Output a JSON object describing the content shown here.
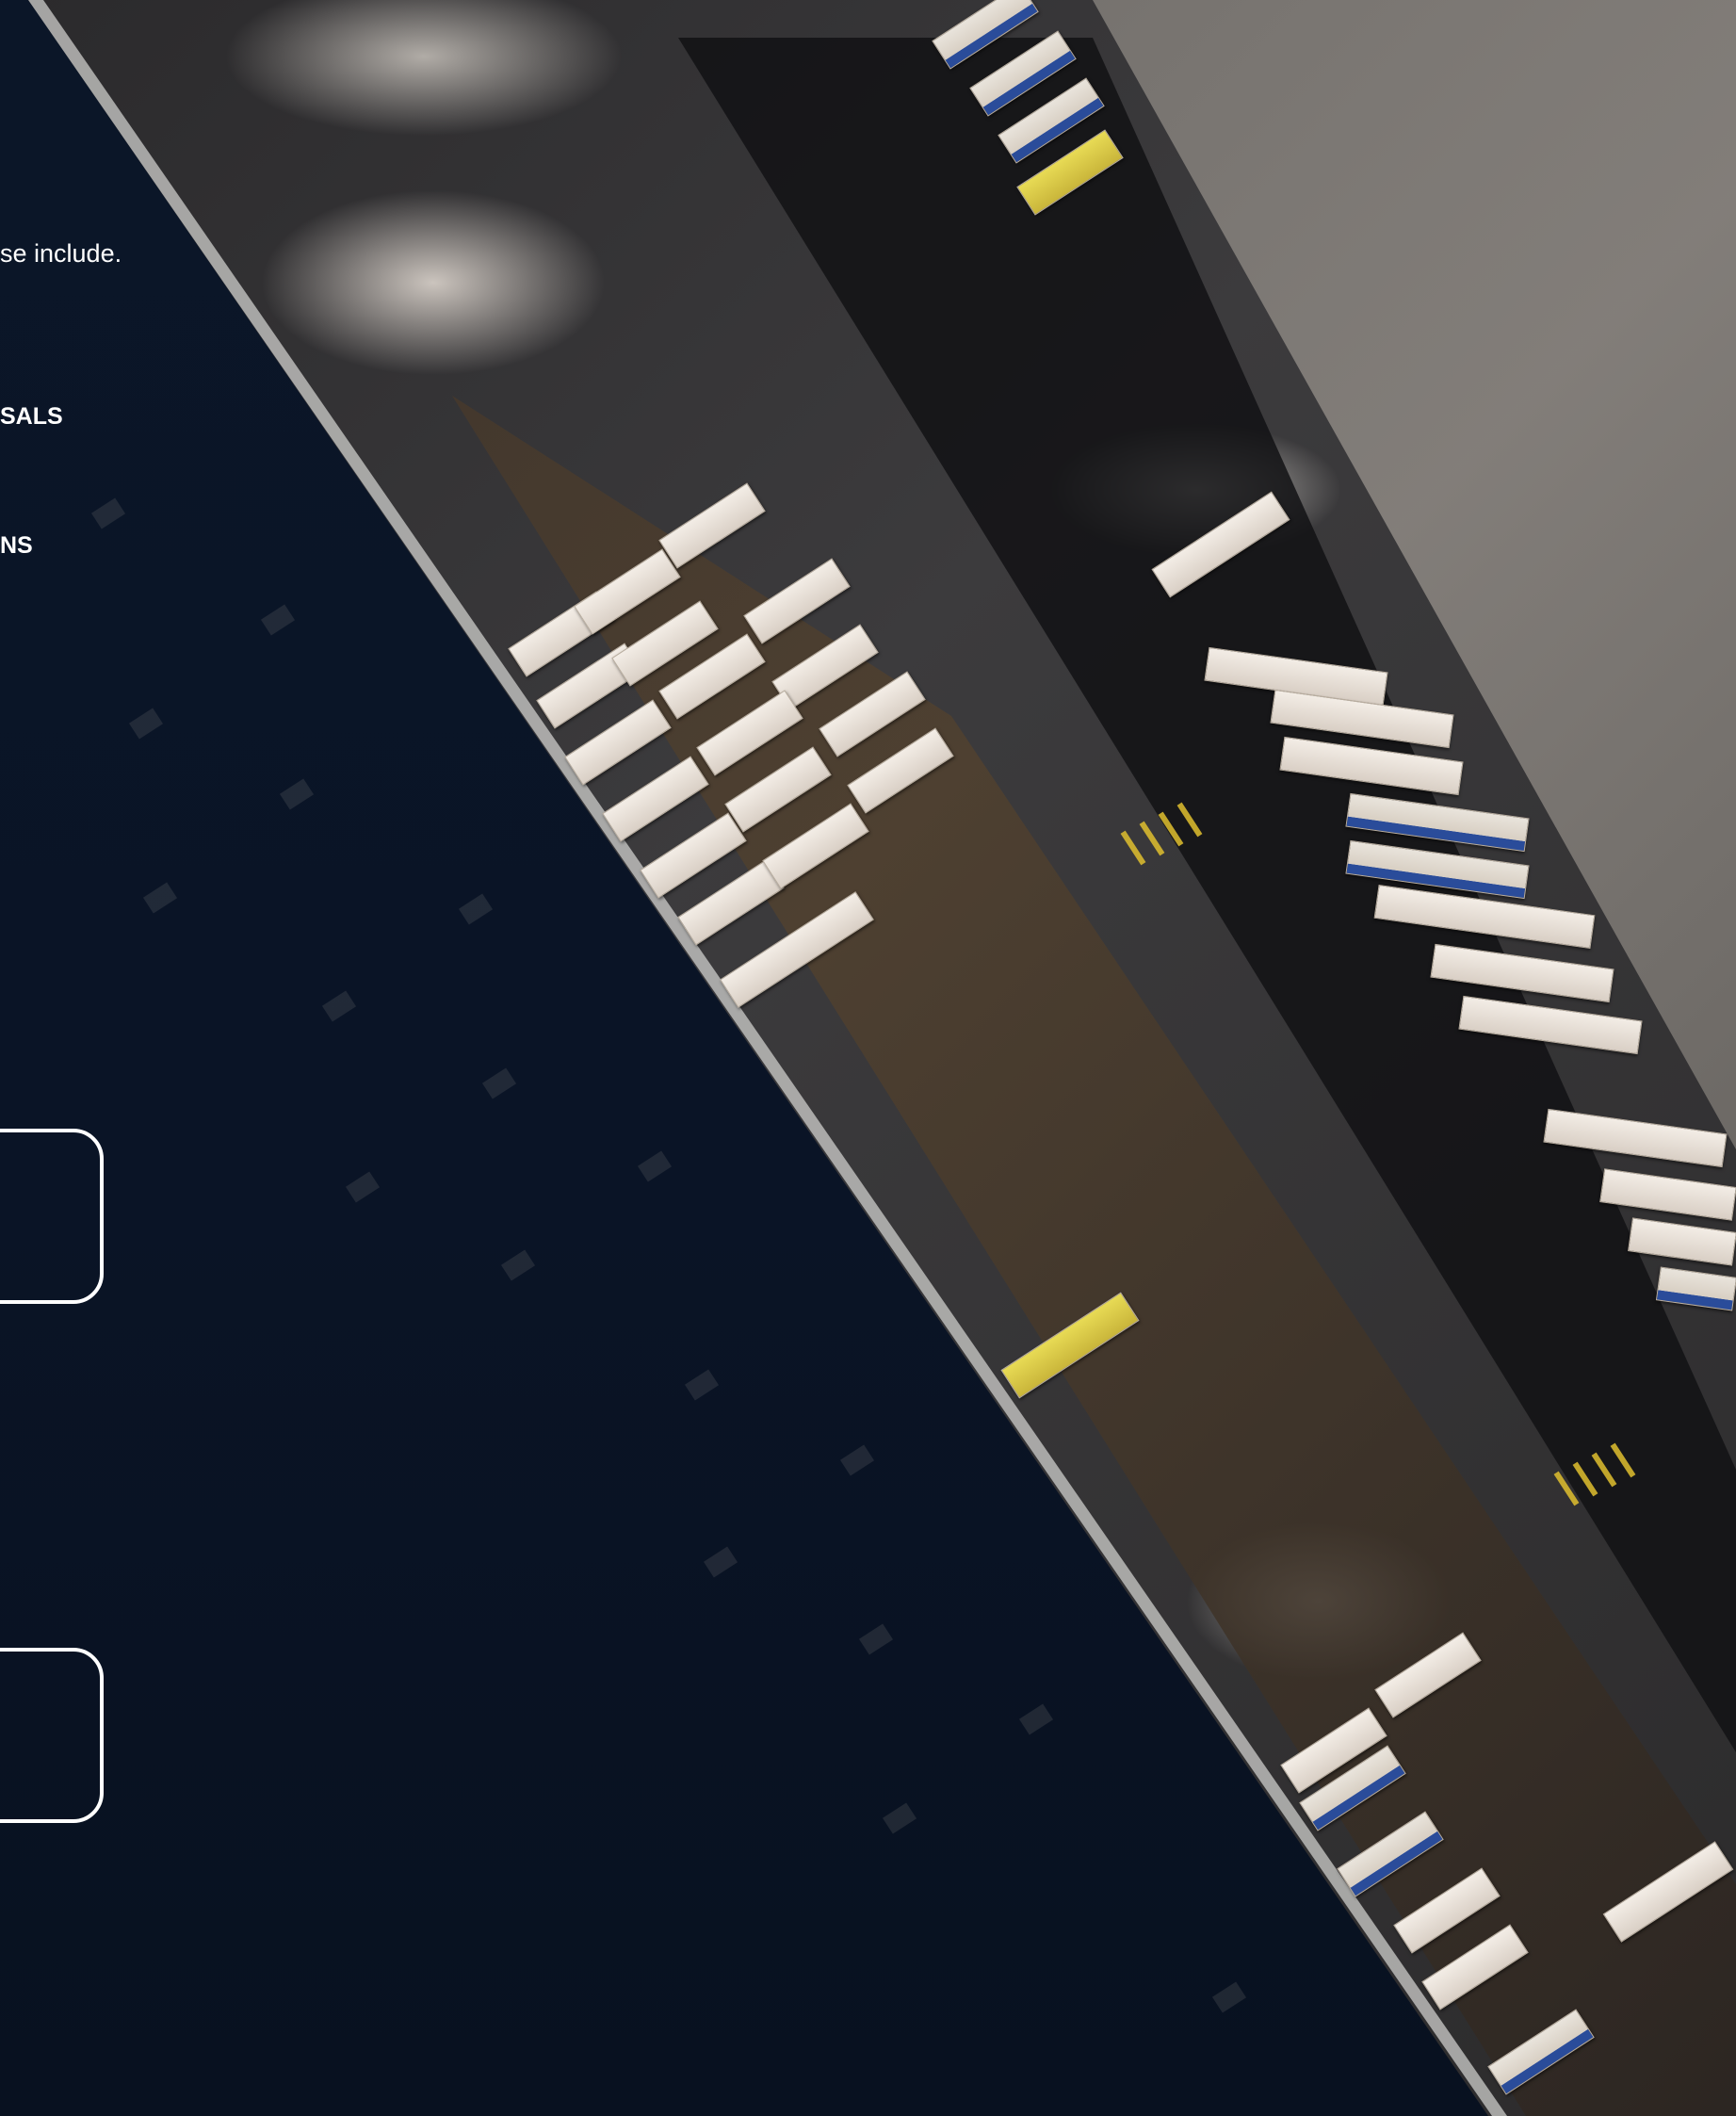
{
  "content": {
    "intro_text": "se include.",
    "list_items": [
      {
        "label": "SALS"
      },
      {
        "label": "NS"
      }
    ]
  },
  "cards": [
    {
      "label": ""
    },
    {
      "label": ""
    }
  ],
  "colors": {
    "background": "#0b1426",
    "text": "#ffffff",
    "card_border": "#ffffff"
  }
}
